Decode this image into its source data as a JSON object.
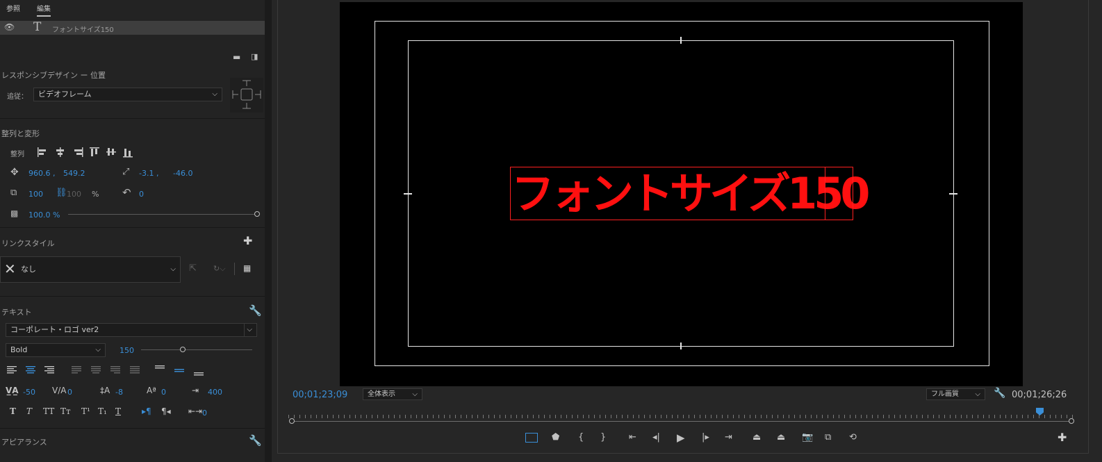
{
  "tabs": [
    {
      "label": "参照"
    },
    {
      "label": "編集"
    }
  ],
  "layer": {
    "name": "フォントサイズ150"
  },
  "responsive": {
    "header": "レスポンシブデザイン ー 位置",
    "pin_label": "追従：",
    "pin_value": "ビデオフレーム"
  },
  "align_transform": {
    "header": "整列と変形",
    "align_label": "整列",
    "position_x": "960.6 ,",
    "position_y": "549.2",
    "anchor_x": "-3.1 ,",
    "anchor_y": "-46.0",
    "scale": "100",
    "scale_linked": "100",
    "percent": "%",
    "rotation": "0",
    "opacity": "100.0 %",
    "opacity_level": 1.0
  },
  "track_styles": {
    "header": "リンクスタイル",
    "value": "なし"
  },
  "text": {
    "header": "テキスト",
    "font": "コーポレート・ロゴ ver2",
    "style": "Bold",
    "size": "150",
    "kerning": "-50",
    "tracking": "0",
    "leading": "-8",
    "baseline": "0",
    "tsume": "400",
    "indent": "0"
  },
  "appearance": {
    "header": "アピアランス"
  },
  "monitor": {
    "title_text": "フォントサイズ150",
    "timecode_left": "00;01;23;09",
    "fit_select": "全体表示",
    "quality_select": "フル画質",
    "timecode_right": "00;01;26;26"
  },
  "colors": {
    "accent": "#3a8fd8",
    "title_red": "#ff1010",
    "panel_bg": "#232323"
  }
}
